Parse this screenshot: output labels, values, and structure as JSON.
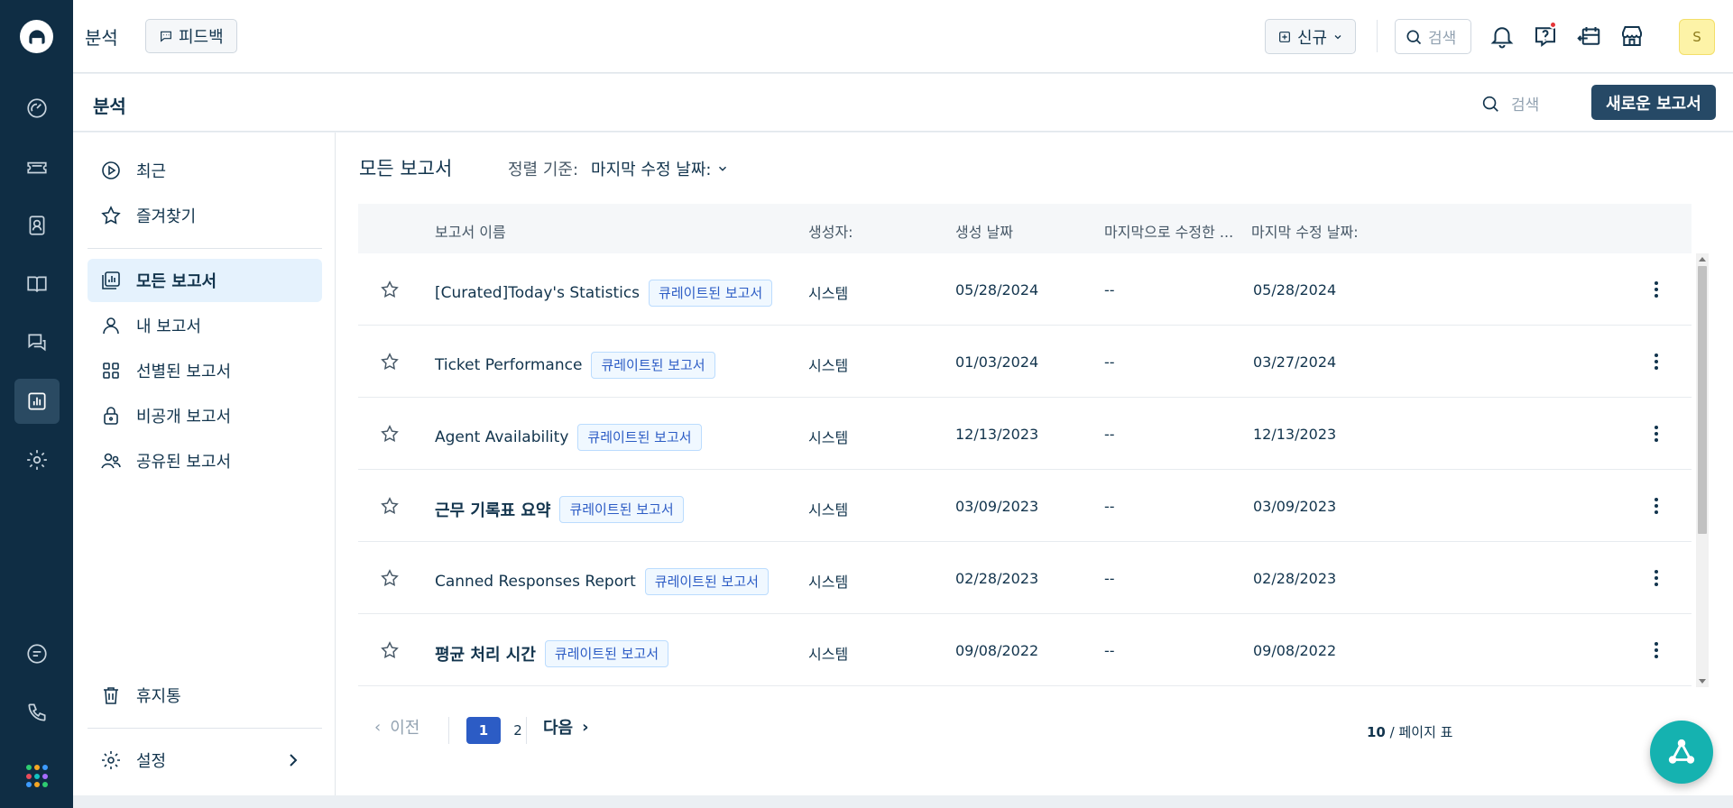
{
  "header": {
    "title": "분석",
    "feedback_label": "피드백",
    "new_label": "신규",
    "search_placeholder": "검색",
    "avatar_initial": "S"
  },
  "subheader": {
    "title": "분석",
    "search_placeholder": "검색",
    "new_report_label": "새로운 보고서"
  },
  "sidebar": {
    "items": [
      {
        "label": "최근",
        "icon": "play-circle-icon"
      },
      {
        "label": "즐겨찾기",
        "icon": "star-icon"
      },
      {
        "label": "모든 보고서",
        "icon": "reports-icon",
        "active": true
      },
      {
        "label": "내 보고서",
        "icon": "user-icon"
      },
      {
        "label": "선별된 보고서",
        "icon": "grid-icon"
      },
      {
        "label": "비공개 보고서",
        "icon": "lock-icon"
      },
      {
        "label": "공유된 보고서",
        "icon": "users-icon"
      }
    ],
    "trash_label": "휴지통",
    "settings_label": "설정"
  },
  "main": {
    "title": "모든 보고서",
    "sort_label": "정렬 기준:",
    "sort_value": "마지막 수정 날짜:",
    "columns": [
      "보고서 이름",
      "생성자:",
      "생성 날짜",
      "마지막으로 수정한 ...",
      "마지막 수정 날짜:"
    ],
    "rows": [
      {
        "name": "[Curated]Today's Statistics",
        "badge": "큐레이트된 보고서",
        "creator": "시스템",
        "created": "05/28/2024",
        "modified_by": "--",
        "modified": "05/28/2024"
      },
      {
        "name": "Ticket Performance",
        "badge": "큐레이트된 보고서",
        "creator": "시스템",
        "created": "01/03/2024",
        "modified_by": "--",
        "modified": "03/27/2024"
      },
      {
        "name": "Agent Availability",
        "badge": "큐레이트된 보고서",
        "creator": "시스템",
        "created": "12/13/2023",
        "modified_by": "--",
        "modified": "12/13/2023"
      },
      {
        "name": "근무 기록표 요약",
        "badge": "큐레이트된 보고서",
        "creator": "시스템",
        "created": "03/09/2023",
        "modified_by": "--",
        "modified": "03/09/2023"
      },
      {
        "name": "Canned Responses Report",
        "badge": "큐레이트된 보고서",
        "creator": "시스템",
        "created": "02/28/2023",
        "modified_by": "--",
        "modified": "02/28/2023"
      },
      {
        "name": "평균 처리 시간",
        "badge": "큐레이트된 보고서",
        "creator": "시스템",
        "created": "09/08/2022",
        "modified_by": "--",
        "modified": "09/08/2022"
      }
    ]
  },
  "pagination": {
    "prev_label": "이전",
    "pages": [
      "1",
      "2"
    ],
    "current_page": "1",
    "next_label": "다음",
    "per_page_value": "10",
    "per_page_label": "/ 페이지 표"
  },
  "colors": {
    "rail": "#0f2d44",
    "primary_button": "#264966",
    "active_page": "#2c5cc5",
    "badge_text": "#2c5cc5",
    "fab": "#15b2b0",
    "notification_dot": "#e43538"
  }
}
